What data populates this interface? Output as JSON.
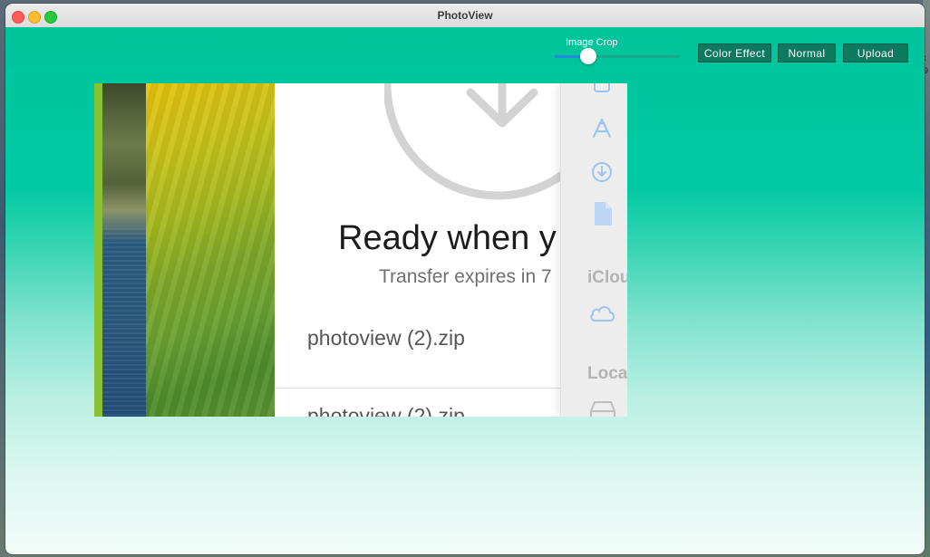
{
  "window": {
    "title": "PhotoView"
  },
  "desktop": {
    "edge_text": [
      "t",
      "9"
    ]
  },
  "toolbar": {
    "crop_label": "Image Crop",
    "crop_value": 0.27,
    "buttons": {
      "color_effect": "Color Effect",
      "normal": "Normal",
      "upload": "Upload"
    }
  },
  "image_content": {
    "heading": "Ready when y",
    "subheading": "Transfer expires in 7",
    "files": [
      "photoview (2).zip",
      "photoview (2).zip"
    ],
    "sidebar_sections": [
      "iClou",
      "Loca"
    ]
  },
  "colors": {
    "header": "#00c49a",
    "button": "#0d7a5f",
    "slider_fill": "#1e8bdc"
  }
}
